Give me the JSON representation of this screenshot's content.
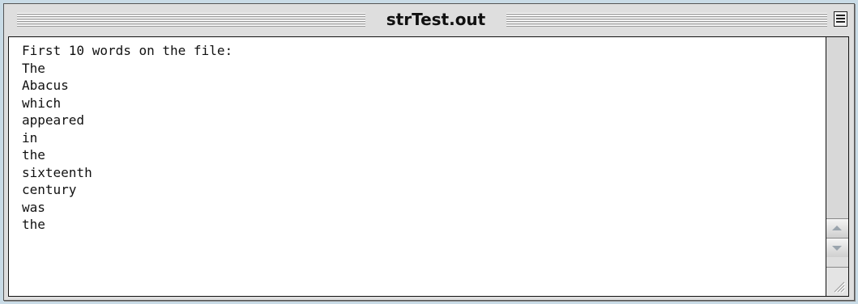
{
  "window": {
    "title": "strTest.out"
  },
  "output": {
    "lines": [
      "First 10 words on the file:",
      "The",
      "Abacus",
      "which",
      "appeared",
      "in",
      "the",
      "sixteenth",
      "century",
      "was",
      "the"
    ]
  },
  "icons": {
    "zoom": "zoom-box-icon",
    "scroll_up": "scroll-up-arrow-icon",
    "scroll_down": "scroll-down-arrow-icon",
    "resize": "resize-grip-icon"
  },
  "colors": {
    "background": "#c9dbe6",
    "window_chrome": "#dedede",
    "text_area": "#ffffff",
    "text": "#111111"
  }
}
